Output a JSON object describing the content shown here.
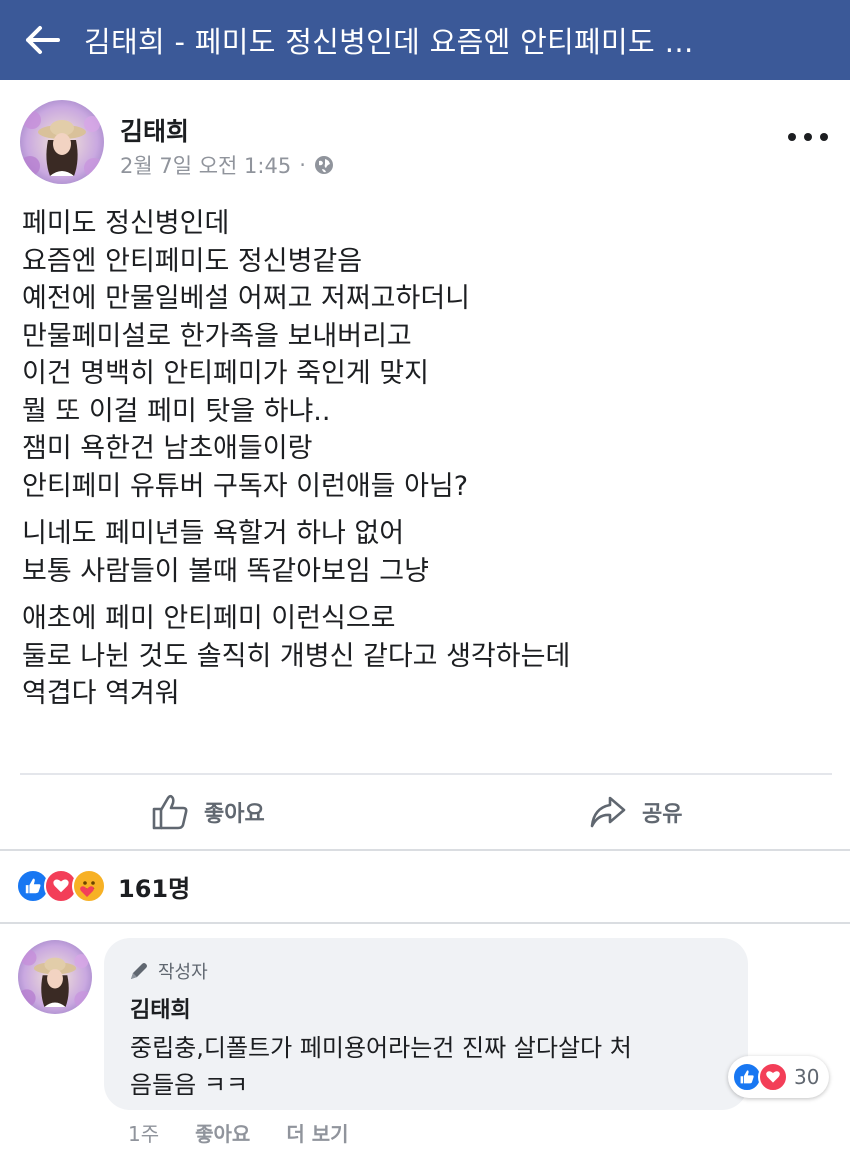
{
  "topbar": {
    "title": "김태희 - 페미도 정신병인데 요즘엔 안티페미도 …",
    "back_icon": "arrow-left-icon",
    "background": "#3b5998"
  },
  "post": {
    "author": "김태희",
    "timestamp": "2월 7일 오전 1:45",
    "separator": "·",
    "privacy_icon": "globe-icon",
    "more_icon": "more-dots-icon",
    "paragraphs": [
      {
        "lines": [
          "페미도 정신병인데",
          "요즘엔 안티페미도 정신병같음",
          "예전에 만물일베설 어쩌고 저쩌고하더니",
          "만물페미설로 한가족을 보내버리고",
          "이건 명백히 안티페미가 죽인게 맞지",
          "뭘 또 이걸 페미 탓을 하냐..",
          "잼미 욕한건 남초애들이랑",
          "안티페미 유튜버 구독자 이런애들 아님?"
        ]
      },
      {
        "lines": [
          "니네도 페미년들 욕할거 하나 없어",
          "보통 사람들이 볼때 똑같아보임 그냥"
        ]
      },
      {
        "lines": [
          "애초에 페미 안티페미 이런식으로",
          "둘로 나뉜 것도 솔직히 개병신 같다고 생각하는데",
          "역겹다 역겨워"
        ]
      }
    ]
  },
  "actions": {
    "like_label": "좋아요",
    "share_label": "공유"
  },
  "reactions": {
    "count": "161명",
    "icons": [
      "like-icon",
      "love-icon",
      "care-icon"
    ],
    "like_color": "#1877f2",
    "love_color": "#f33e58",
    "care_color": "#f7b125"
  },
  "comment": {
    "badge": "작성자",
    "badge_icon": "pen-icon",
    "author": "김태희",
    "lines": [
      "중립충,디폴트가 페미용어라는건 진짜 살다살다 처",
      "음들음 ㅋㅋ"
    ],
    "reaction_count": "30",
    "time": "1주",
    "like_label": "좋아요",
    "more_label": "더 보기"
  }
}
